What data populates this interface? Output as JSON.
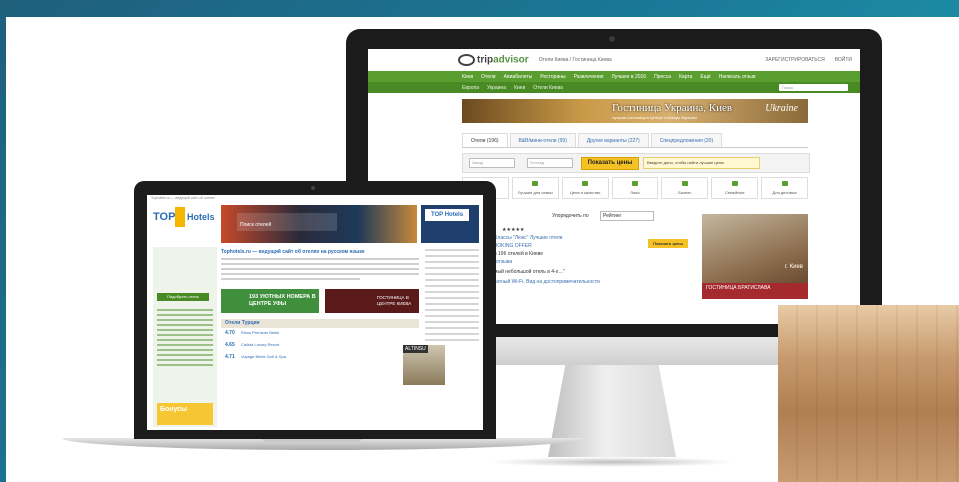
{
  "imac": {
    "tripadvisor": {
      "logo_trip": "trip",
      "logo_advisor": "advisor",
      "top_crumb": "Отели Киева / Гостиница Киева",
      "top_links": [
        "ЗАРЕГИСТРИРОВАТЬСЯ",
        "ВОЙТИ"
      ],
      "nav": [
        "Киев",
        "Отели",
        "Авиабилеты",
        "Рестораны",
        "Развлечения",
        "Лучшее в 2016",
        "Пресса",
        "Карта",
        "Ещё",
        "Написать отзыв"
      ],
      "breadcrumb": [
        "Европа",
        "Украина",
        "Киев",
        "Отели Киева"
      ],
      "search_placeholder": "Поиск",
      "banner": {
        "title": "Гостиница Украина, Киев",
        "subtitle": "лучшая гостиница в центре столицы Украины",
        "brand": "Ukraine"
      },
      "tabs": [
        "Отели (196)",
        "B&B/мини-отели (99)",
        "Другие варианты (227)",
        "Спецпредложения (20)"
      ],
      "checkin_placeholder": "Заезд",
      "checkout_placeholder": "Отъезд",
      "show_prices": "Показать цены",
      "dates_hint": "Введите даты, чтобы найти лучшие цены",
      "categories": [
        "",
        "Лучшие для семьи",
        "Цена и качество",
        "Люкс",
        "Бизнес",
        "Семейные",
        "Для деловых"
      ],
      "sort_label": "Упорядочить по",
      "sort_value": "Рейтинг",
      "list_lines": [
        "2016 Классы \"Люкс\" Лучшие отели",
        "EE BOOKING OFFER",
        "№1 из 196 отелей в Киеве",
        "5 724 отзыва",
        "\"…самый небольшой отель в 4-х…\"",
        "Бесплатный Wi-Fi, Вид на достопримечательности"
      ],
      "show_prices_small": "Показать цены",
      "ad": {
        "city": "г. Киев",
        "name": "ГОСТИНИЦА БРАТИСЛАВА"
      }
    }
  },
  "macbook": {
    "tophotels": {
      "top_bar": "Tophotels.ru — ведущий сайт об отелях",
      "logo_top": "TOP",
      "logo_hotels": "Hotels",
      "hero_search": "Поиск отелей",
      "side_banner_logo": "TOP Hotels",
      "side_button": "Подобрать отель",
      "intro_title": "Tophotels.ru — ведущий сайт об отелях на русском языке",
      "promo1": "193 УЮТНЫХ НОМЕРА В ЦЕНТРЕ УФЫ",
      "promo2": "ГОСТИНИЦА В ЦЕНТРЕ КИЕВА",
      "section_title": "Отели Турции",
      "rows": [
        {
          "score": "4.70",
          "name": "Rixos Premium Belek"
        },
        {
          "score": "4.65",
          "name": "Calista Luxury Resort"
        },
        {
          "score": "4.71",
          "name": "Voyage Belek Golf & Spa"
        }
      ],
      "hotel_label": "ALTINSU",
      "bonus": "Бонусы"
    }
  }
}
